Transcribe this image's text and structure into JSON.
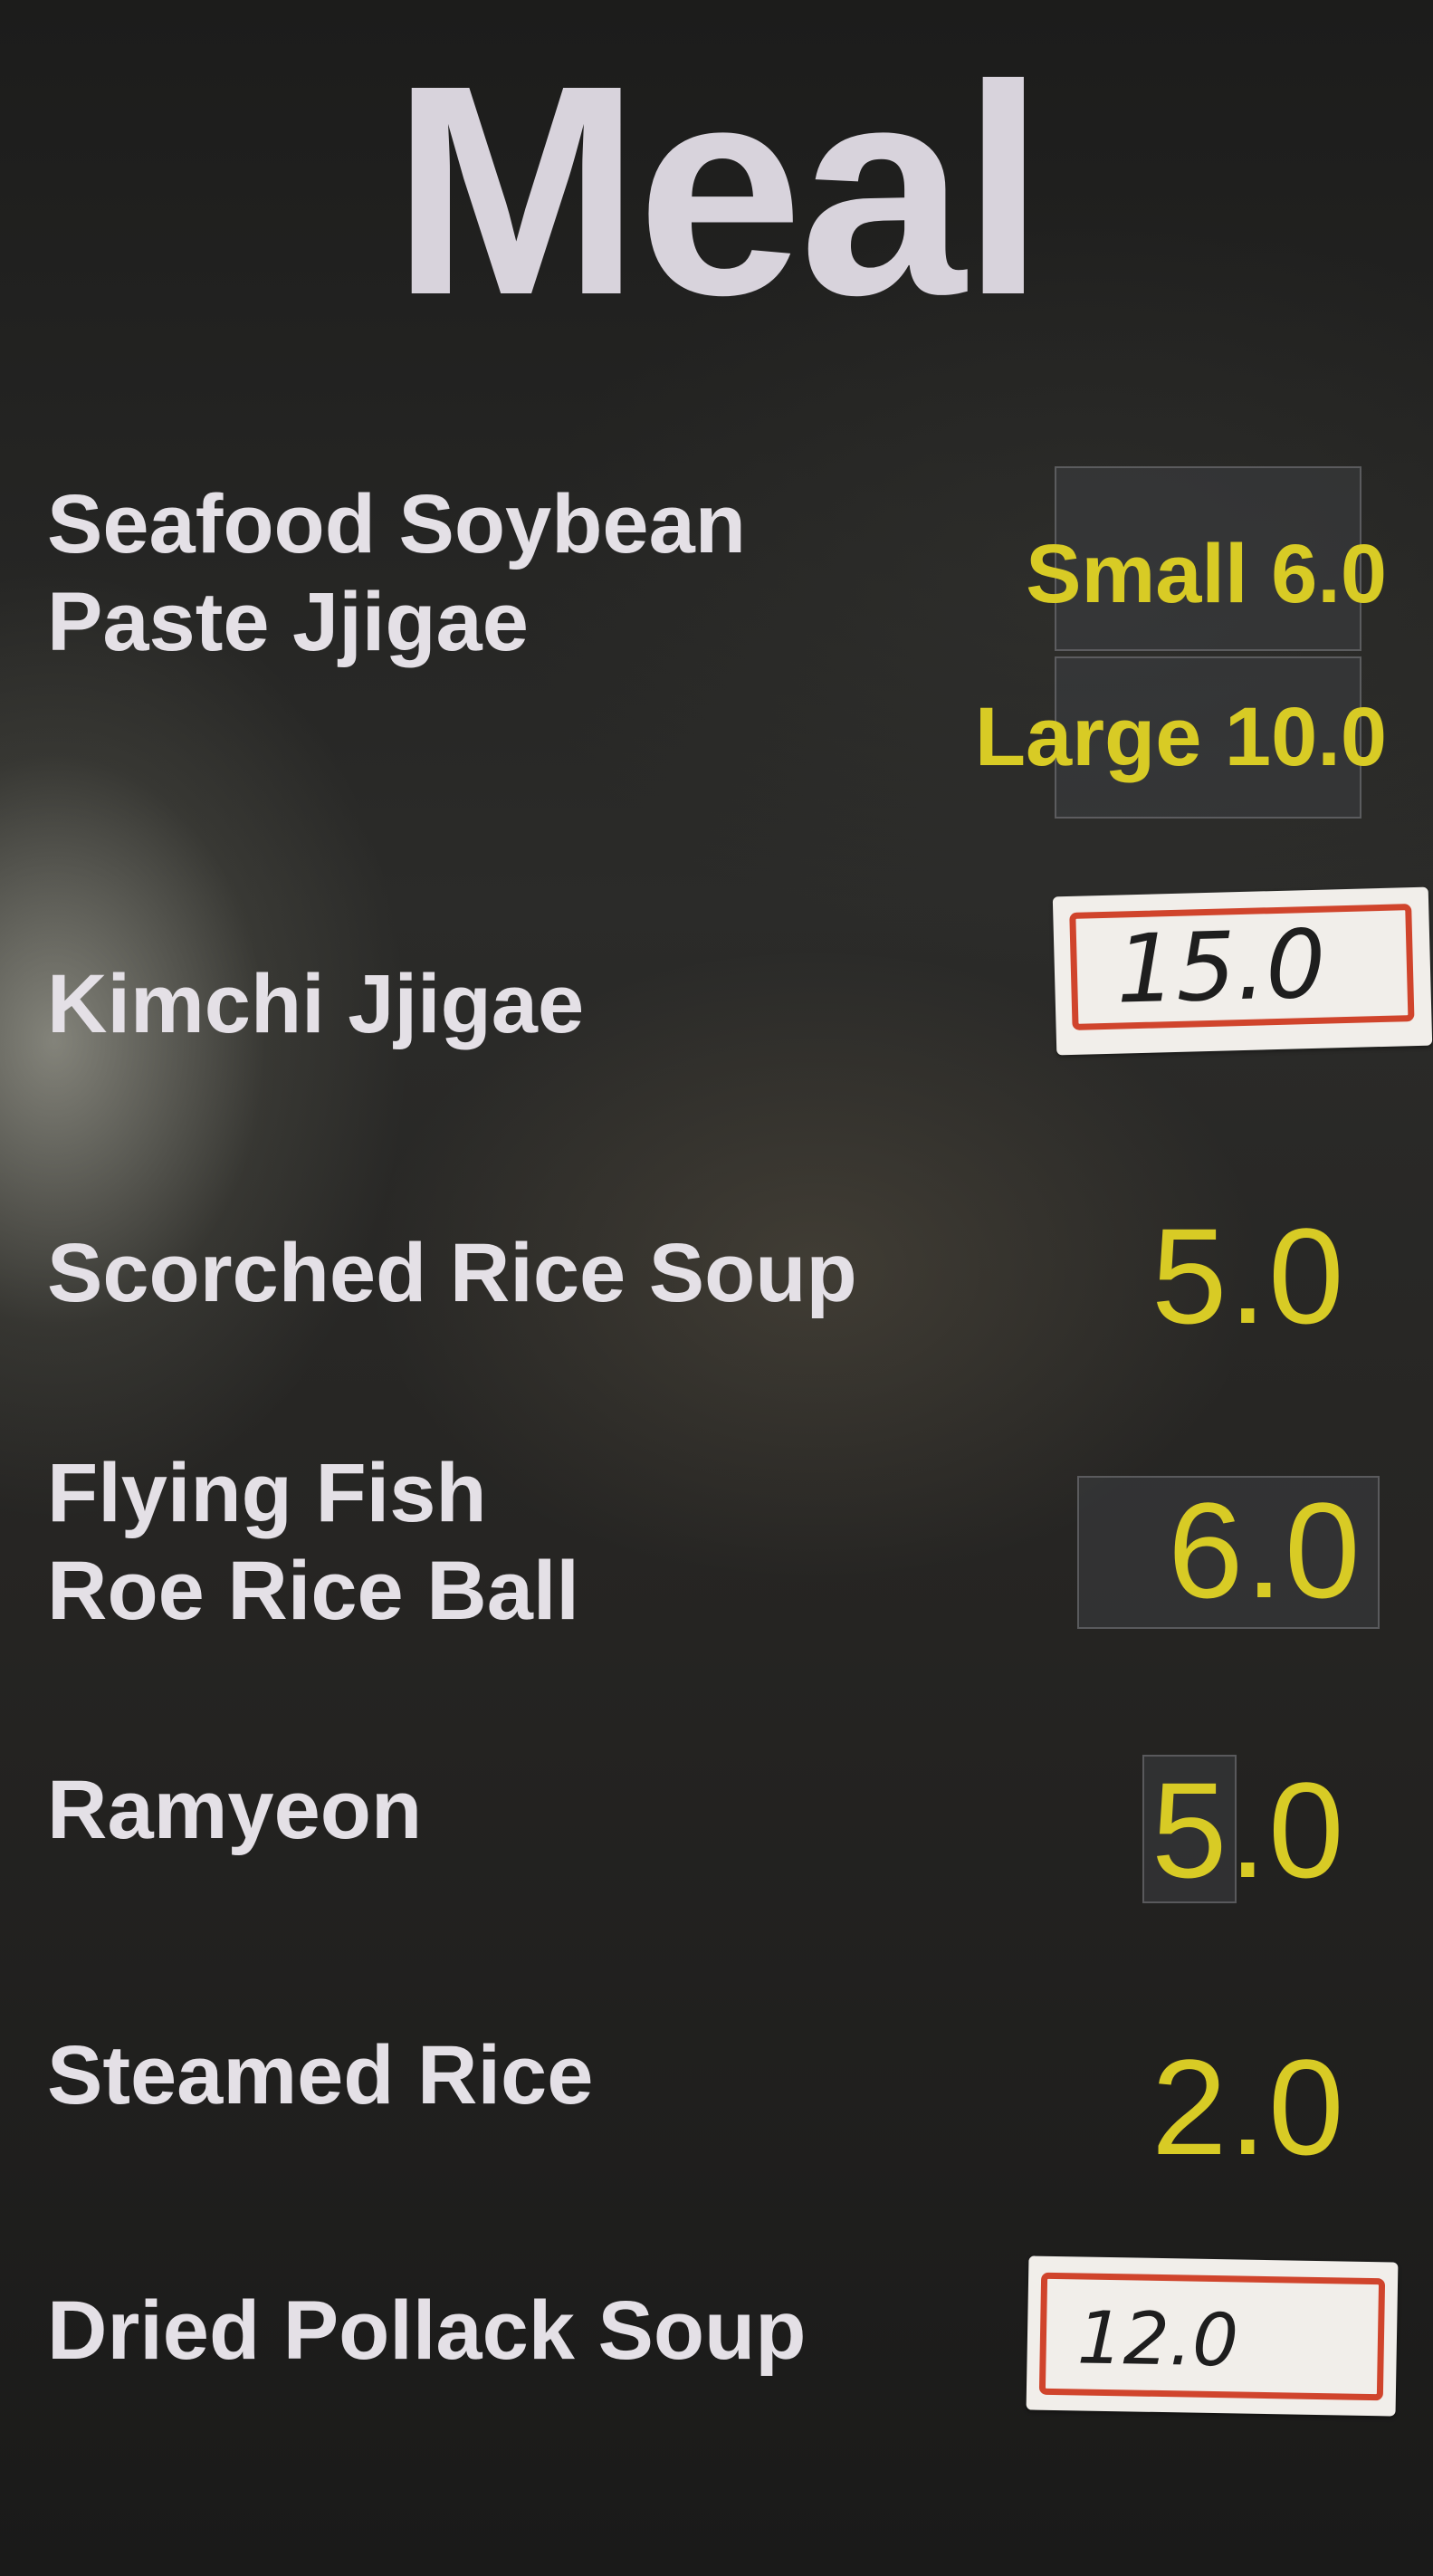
{
  "title": "Meal",
  "items": [
    {
      "name_lines": [
        "Seafood Soybean",
        "Paste Jjigae"
      ],
      "prices": [
        "Small 6.0",
        "Large 10.0"
      ]
    },
    {
      "name_lines": [
        "Kimchi Jjigae"
      ],
      "price": "15.0",
      "price_style": "handwritten-label"
    },
    {
      "name_lines": [
        "Scorched Rice Soup"
      ],
      "price": "5.0"
    },
    {
      "name_lines": [
        "Flying Fish",
        "Roe Rice Ball"
      ],
      "price": "6.0"
    },
    {
      "name_lines": [
        "Ramyeon"
      ],
      "price": "5.0"
    },
    {
      "name_lines": [
        "Steamed Rice"
      ],
      "price": "2.0"
    },
    {
      "name_lines": [
        "Dried Pollack Soup"
      ],
      "price": "12.0",
      "price_style": "handwritten-label"
    }
  ],
  "colors": {
    "background": "#222220",
    "title": "#d8d3dc",
    "item_text": "#e4e0e6",
    "price": "#d8cb25",
    "label_border": "#d0442c",
    "label_paper": "#f1eeea"
  }
}
